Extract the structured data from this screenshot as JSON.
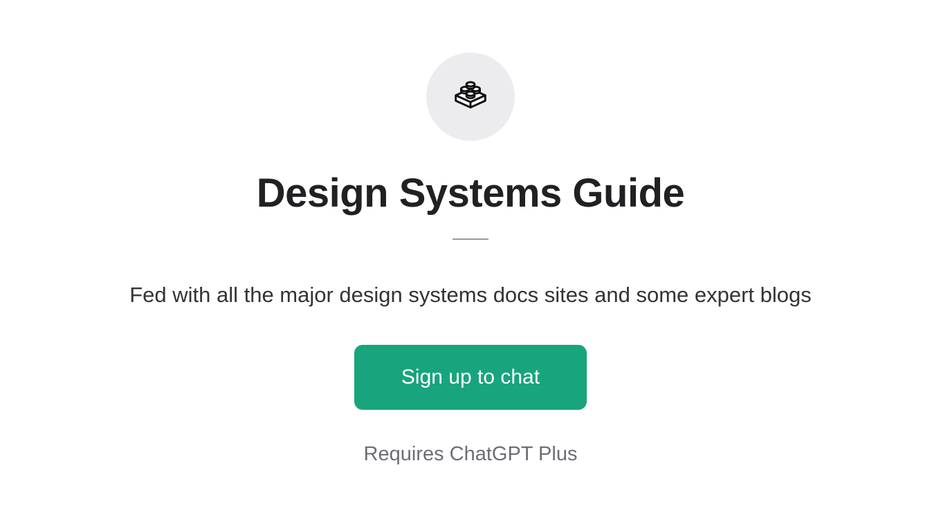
{
  "icon_name": "block-icon",
  "title": "Design Systems Guide",
  "description": "Fed with all the major design systems docs sites and some expert blogs",
  "cta_label": "Sign up to chat",
  "requirement_text": "Requires ChatGPT Plus",
  "colors": {
    "icon_bg": "#ececee",
    "title": "#202123",
    "description": "#333337",
    "cta_bg": "#18a47c",
    "cta_text": "#ffffff",
    "requirement": "#6d6d76",
    "divider": "#9a9a9e"
  }
}
